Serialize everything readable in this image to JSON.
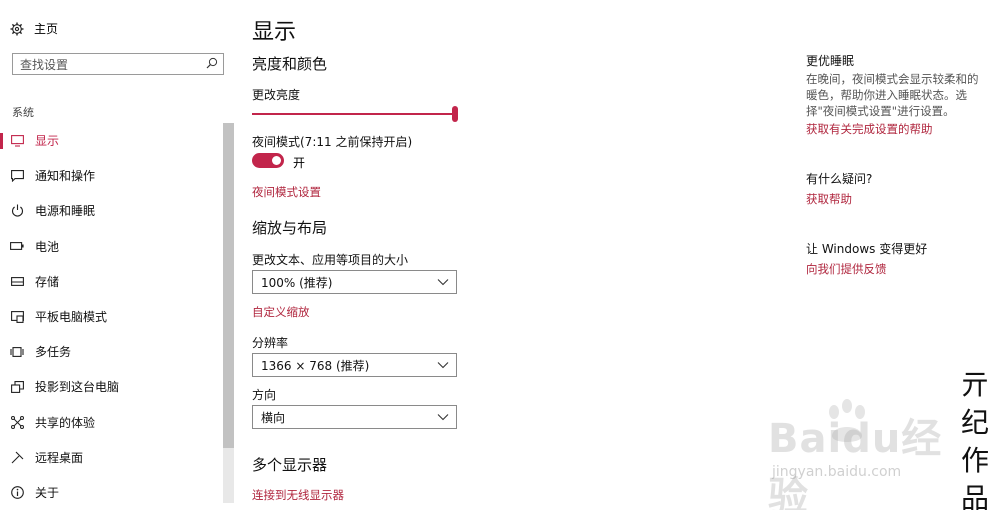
{
  "sidebar": {
    "home_label": "主页",
    "search_placeholder": "查找设置",
    "section_label": "系统",
    "items": [
      {
        "label": "显示",
        "icon": "monitor-icon",
        "active": true
      },
      {
        "label": "通知和操作",
        "icon": "notification-icon"
      },
      {
        "label": "电源和睡眠",
        "icon": "power-icon"
      },
      {
        "label": "电池",
        "icon": "battery-icon"
      },
      {
        "label": "存储",
        "icon": "storage-icon"
      },
      {
        "label": "平板电脑模式",
        "icon": "tablet-mode-icon"
      },
      {
        "label": "多任务",
        "icon": "multitasking-icon"
      },
      {
        "label": "投影到这台电脑",
        "icon": "projection-icon"
      },
      {
        "label": "共享的体验",
        "icon": "shared-experience-icon"
      },
      {
        "label": "远程桌面",
        "icon": "remote-desktop-icon"
      },
      {
        "label": "关于",
        "icon": "info-icon"
      }
    ]
  },
  "main": {
    "title": "显示",
    "brightness_section": "亮度和颜色",
    "brightness_label": "更改亮度",
    "brightness_value": 1.0,
    "night_mode_label": "夜间模式(7:11 之前保持开启)",
    "night_mode_state": "开",
    "night_mode_settings_link": "夜间模式设置",
    "scale_section": "缩放与布局",
    "scale_label": "更改文本、应用等项目的大小",
    "scale_value": "100% (推荐)",
    "custom_scale_link": "自定义缩放",
    "resolution_label": "分辨率",
    "resolution_value": "1366 × 768 (推荐)",
    "orientation_label": "方向",
    "orientation_value": "横向",
    "multi_display_section": "多个显示器",
    "wireless_display_link": "连接到无线显示器"
  },
  "right": {
    "sleep_title": "更优睡眠",
    "sleep_text": "在晚间，夜间模式会显示较柔和的暖色，帮助你进入睡眠状态。选择\"夜间模式设置\"进行设置。",
    "sleep_link": "获取有关完成设置的帮助",
    "question_title": "有什么疑问?",
    "question_link": "获取帮助",
    "improve_title": "让 Windows 变得更好",
    "improve_link": "向我们提供反馈"
  },
  "watermark": {
    "text": "Baidu经验",
    "url": "jingyan.baidu.com",
    "signature": "亓纪作品"
  },
  "colors": {
    "accent": "#c2254b",
    "link": "#b0263e"
  }
}
